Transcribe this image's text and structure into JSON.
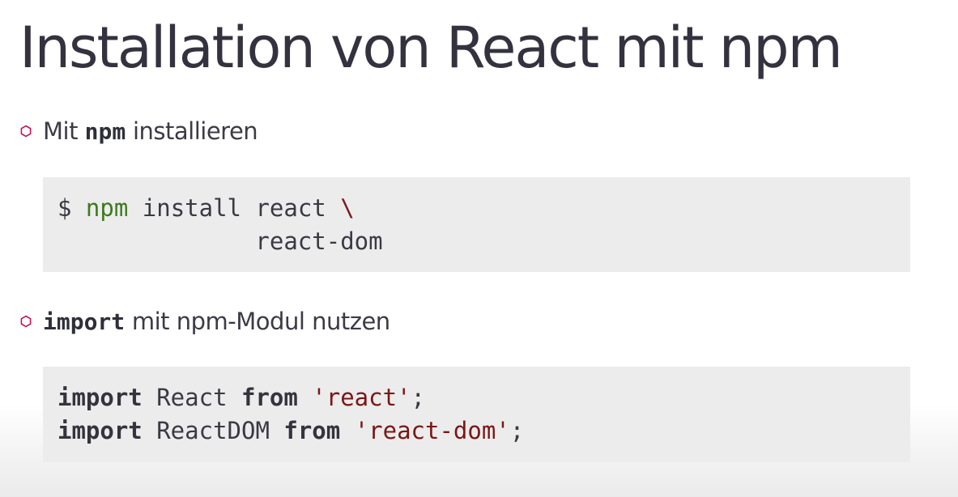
{
  "slide": {
    "title": "Installation von React mit npm"
  },
  "bullets": [
    {
      "code": "npm",
      "text_before": "Mit ",
      "text_after": " installieren"
    },
    {
      "code": "import",
      "text_before": "",
      "text_after": " mit npm-Modul nutzen"
    }
  ],
  "code_blocks": {
    "install": {
      "prompt": "$ ",
      "command": "npm",
      "args": " install react ",
      "continuation": "\\",
      "line2": "              react-dom"
    },
    "imports": {
      "line1": {
        "kw1": "import",
        "name": " React ",
        "kw2": "from",
        "sp": " ",
        "module": "'react'",
        "end": ";"
      },
      "line2": {
        "kw1": "import",
        "name": " ReactDOM ",
        "kw2": "from",
        "sp": " ",
        "module": "'react-dom'",
        "end": ";"
      }
    }
  },
  "colors": {
    "bullet_icon": "#c2185b",
    "command": "#3c7a1f",
    "string": "#7a1616",
    "code_background": "#ececec"
  },
  "icons": {
    "bullet": "hexagon-outline-icon"
  }
}
